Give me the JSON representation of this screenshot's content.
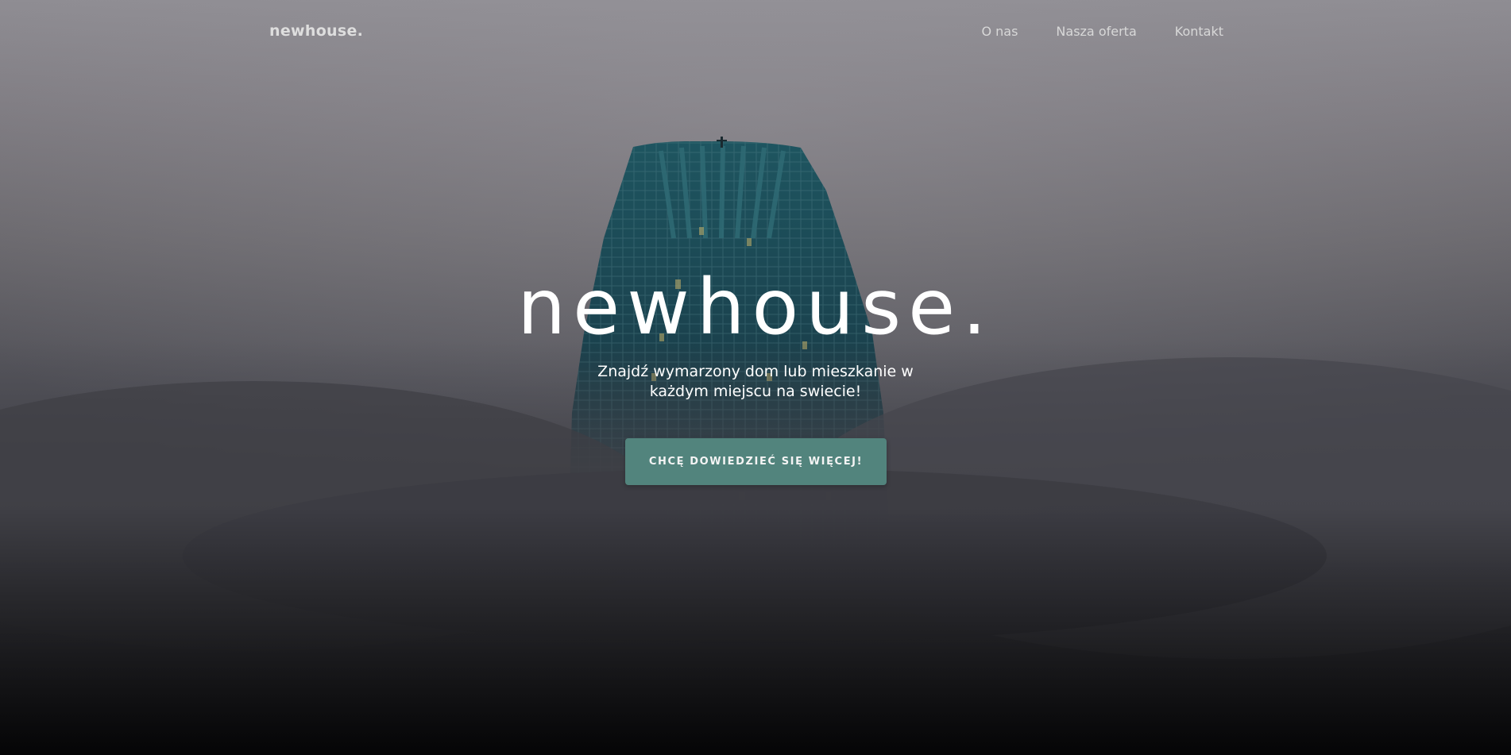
{
  "navbar": {
    "brand": "newhouse.",
    "links": [
      {
        "label": "O nas"
      },
      {
        "label": "Nasza oferta"
      },
      {
        "label": "Kontakt"
      }
    ]
  },
  "hero": {
    "title": "newhouse.",
    "subtitle": "Znajdź wymarzony dom lub mieszkanie w każdym miejscu na swiecie!",
    "cta_label": "CHCĘ DOWIEDZIEĆ SIĘ WIĘCEJ!",
    "background_image": "skyscraper-in-fog",
    "cta_color": "#52847d"
  }
}
